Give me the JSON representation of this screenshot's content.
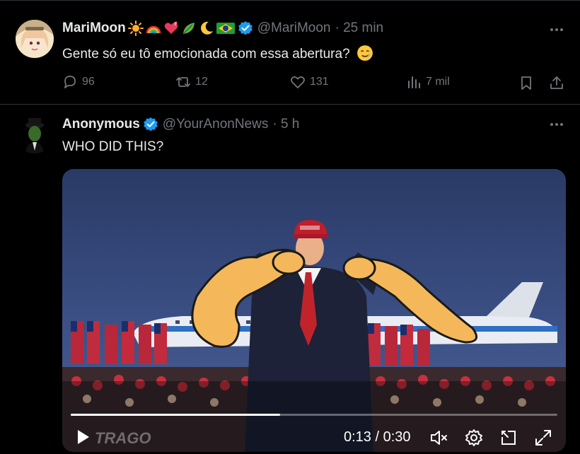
{
  "tweet1": {
    "name": "MariMoon",
    "handle": "@MariMoon",
    "time": "· 25 min",
    "text": "Gente só eu tô emocionada com essa abertura?",
    "actions": {
      "replies": "96",
      "retweets": "12",
      "likes": "131",
      "views": "7 mil"
    },
    "icons": [
      "sun-emoji",
      "rainbow-emoji",
      "heart-emoji",
      "leaf-emoji",
      "moon-emoji",
      "brazil-flag-emoji",
      "verified-badge-icon",
      "more-icon",
      "smiling-tear-emoji"
    ]
  },
  "tweet2": {
    "name": "Anonymous",
    "handle": "@YourAnonNews",
    "time": "· 5 h",
    "text": "WHO DID THIS?",
    "video": {
      "time_display": "0:13 / 0:30",
      "progress": 0.43,
      "watermark": "TRAGO",
      "icons": [
        "play-icon",
        "mute-icon",
        "settings-icon",
        "pip-icon",
        "fullscreen-icon"
      ]
    }
  },
  "colors": {
    "background": "#000000",
    "text": "#e7e9ea",
    "muted": "#71767b",
    "verified": "#1d9bf0",
    "border": "#2f3336"
  }
}
